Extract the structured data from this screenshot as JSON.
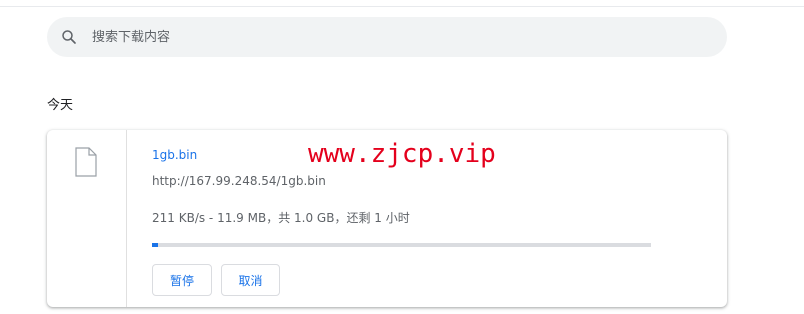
{
  "search": {
    "placeholder": "搜索下载内容",
    "icon": "search-icon"
  },
  "date_group": {
    "label": "今天"
  },
  "download": {
    "file_icon": "file-icon",
    "filename": "1gb.bin",
    "url": "http://167.99.248.54/1gb.bin",
    "status": "211 KB/s - 11.9 MB，共 1.0 GB，还剩 1 小时",
    "progress_percent": 1.16,
    "pause_label": "暂停",
    "cancel_label": "取消"
  },
  "watermark": "www.zjcp.vip",
  "colors": {
    "accent": "#1a73e8",
    "watermark": "#e4001c",
    "search_bg": "#f1f3f4"
  }
}
